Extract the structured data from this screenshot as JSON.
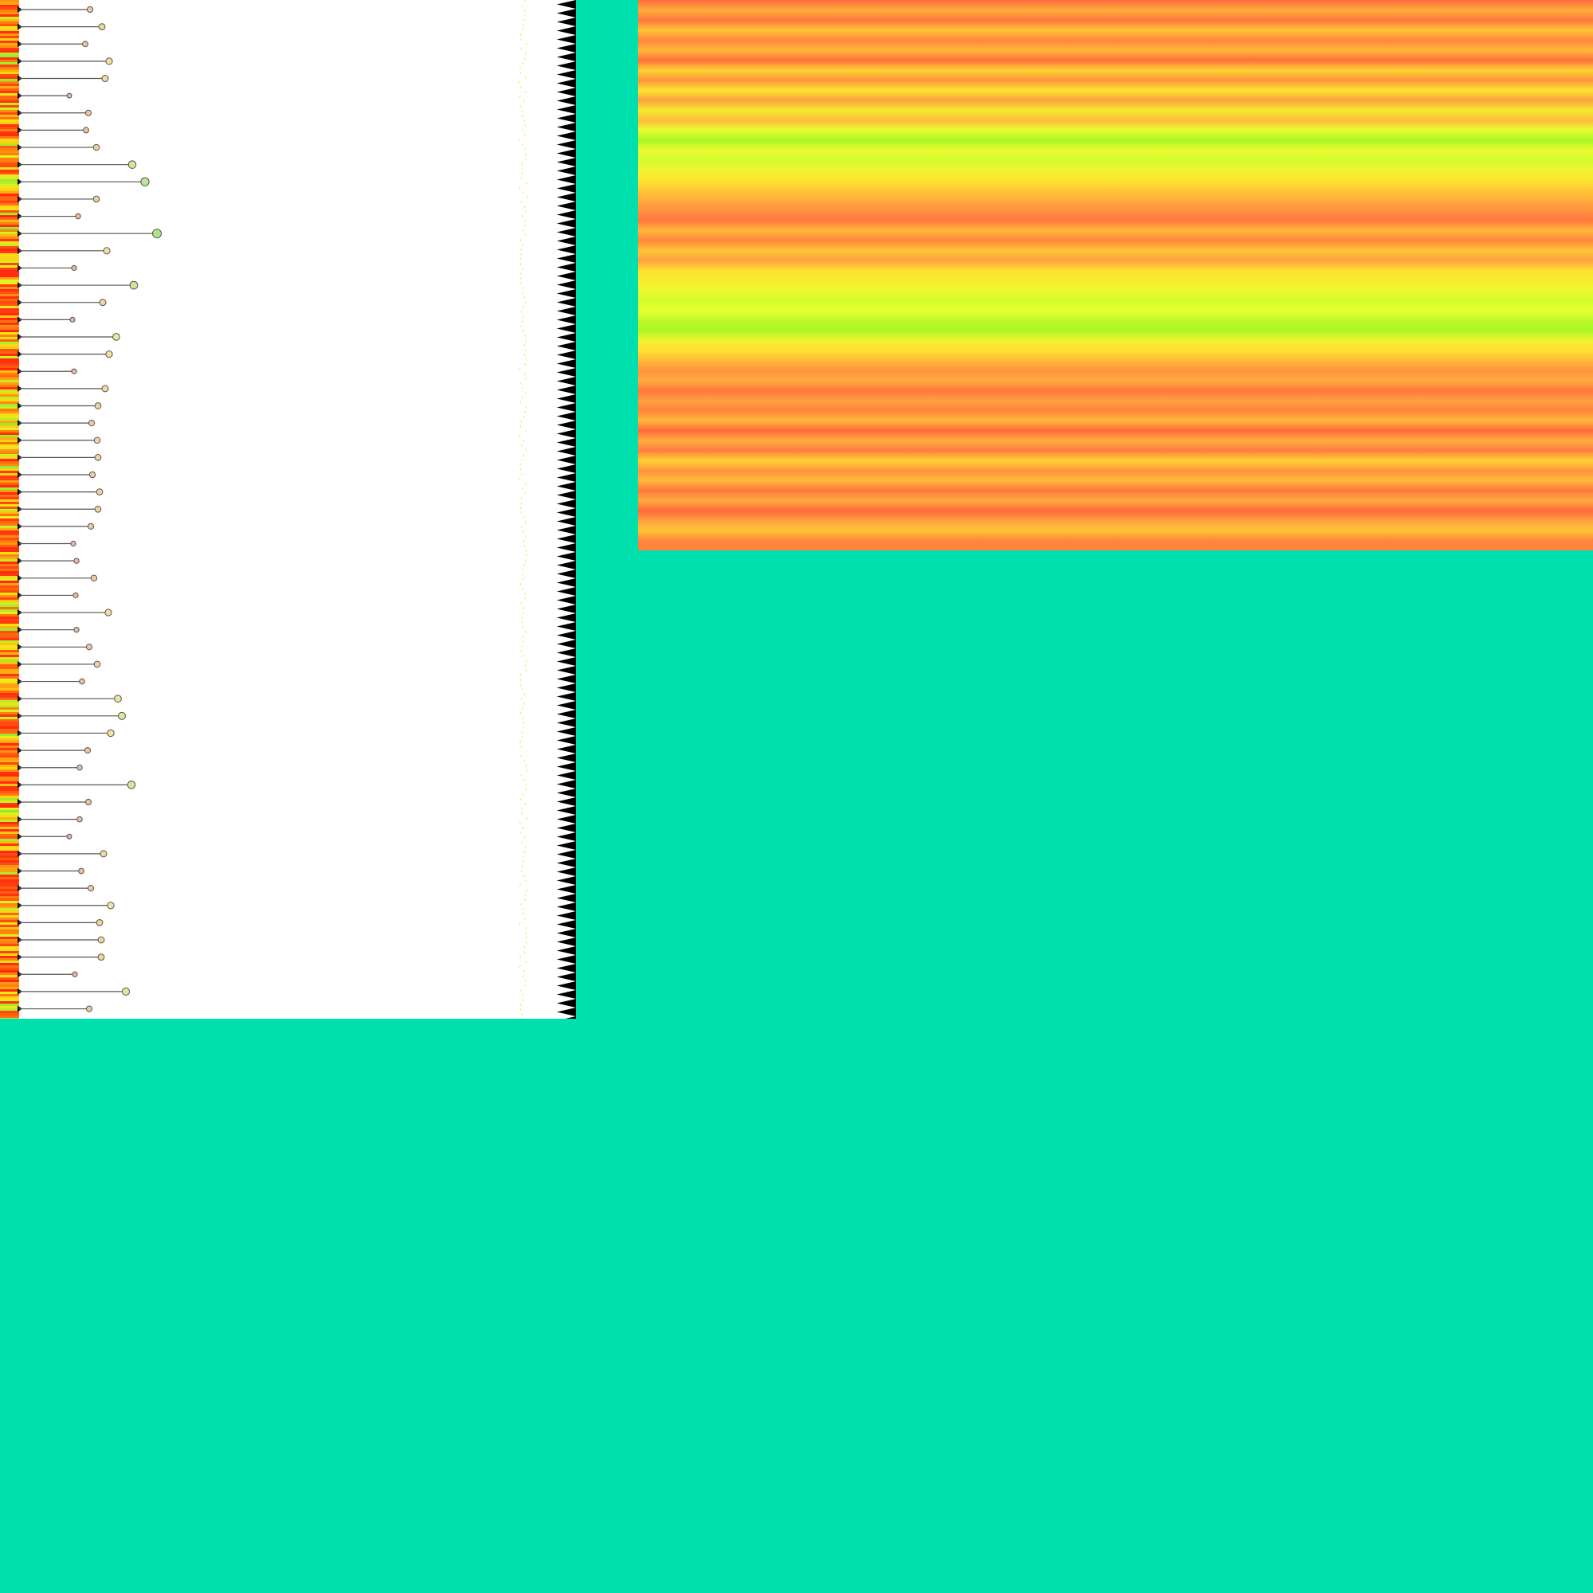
{
  "chart_data": [
    {
      "type": "lollipop",
      "orientation": "horizontal",
      "title": "",
      "xlabel": "",
      "ylabel": "",
      "grid": false,
      "legend": "none",
      "series": [
        {
          "values": [
            113,
            128,
            107,
            137,
            132,
            87,
            111,
            108,
            121,
            166,
            182,
            121,
            98,
            197,
            134,
            93,
            168,
            129,
            91,
            146,
            137,
            93,
            132,
            123,
            115,
            122,
            123,
            116,
            125,
            123,
            114,
            92,
            96,
            118,
            95,
            136,
            96,
            112,
            122,
            103,
            148,
            153,
            139,
            110,
            100,
            165,
            111,
            100,
            87,
            130,
            102,
            114,
            139,
            125,
            127,
            127,
            94,
            158,
            112
          ]
        }
      ],
      "marker_colors": {
        "low": "#e8b0a0",
        "mid": "#f2e6a0",
        "high": "#a8e888"
      }
    },
    {
      "type": "heatmap",
      "title": "",
      "colorscale": [
        "#ff5a3c",
        "#ffa040",
        "#ffe030",
        "#e8ff30",
        "#80f020"
      ],
      "orientation": "horizontal-bands",
      "values": [
        0.05,
        0.3,
        0.1,
        0.4,
        0.15,
        0.35,
        0.08,
        0.45,
        0.2,
        0.55,
        0.25,
        0.6,
        0.35,
        0.75,
        0.9,
        0.7,
        0.8,
        0.65,
        0.55,
        0.4,
        0.3,
        0.2,
        0.1,
        0.35,
        0.15,
        0.4,
        0.25,
        0.5,
        0.6,
        0.7,
        0.8,
        0.75,
        0.85,
        0.9,
        0.65,
        0.5,
        0.35,
        0.2,
        0.3,
        0.1,
        0.25,
        0.15,
        0.35,
        0.05,
        0.3,
        0.12,
        0.45,
        0.2,
        0.35,
        0.1,
        0.3,
        0.05,
        0.25,
        0.4,
        0.15
      ]
    }
  ],
  "colors": {
    "background": "#00dfae",
    "panel": "#ffffff",
    "stem": "#555555",
    "teeth": "#000000",
    "dash_trace": "#f2f07a"
  }
}
